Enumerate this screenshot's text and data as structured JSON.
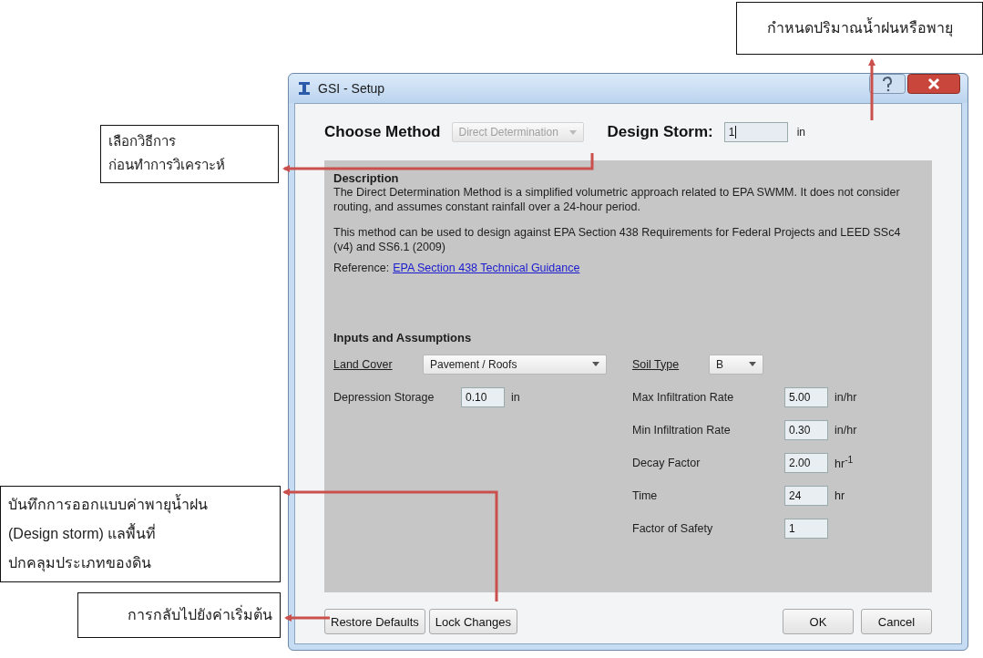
{
  "callouts": [
    {
      "text": "กำหนดปริมาณน้ำฝนหรือพายุ"
    },
    {
      "text": "เลือกวิธีการ\nก่อนทำการวิเคราะห์"
    },
    {
      "text": "บันทึกการออกแบบค่าพายุน้ำฝน\n(Design storm) แลพื้นที่\nปกคลุมประเภทของดิน"
    },
    {
      "text": "การกลับไปยังค่าเริ่มต้น"
    }
  ],
  "dialog": {
    "title": "GSI - Setup",
    "method": {
      "label": "Choose Method",
      "value": "Direct Determination",
      "disabled": true
    },
    "design_storm": {
      "label": "Design Storm:",
      "value": "1",
      "unit": "in"
    },
    "description": {
      "heading": "Description",
      "paragraphs": [
        "The Direct Determination Method is a simplified volumetric approach related to EPA SWMM. It does not consider routing, and assumes constant rainfall over a 24-hour period.",
        "This method can be used to design against EPA Section 438 Requirements for Federal Projects and LEED SSc4 (v4) and SS6.1 (2009)"
      ],
      "reference_label": "Reference:",
      "reference_link": "EPA Section 438 Technical Guidance"
    },
    "inputs": {
      "heading": "Inputs and Assumptions",
      "land_cover": {
        "label": "Land Cover",
        "value": "Pavement / Roofs"
      },
      "soil_type": {
        "label": "Soil Type",
        "value": "B"
      },
      "left_params": [
        {
          "label": "Depression Storage",
          "value": "0.10",
          "unit": "in"
        }
      ],
      "right_params": [
        {
          "label": "Max Infiltration Rate",
          "value": "5.00",
          "unit": "in/hr"
        },
        {
          "label": "Min Infiltration Rate",
          "value": "0.30",
          "unit": "in/hr"
        },
        {
          "label": "Decay Factor",
          "value": "2.00",
          "unit": "hr$^{-1}$"
        },
        {
          "label": "Time",
          "value": "24",
          "unit": "hr"
        },
        {
          "label": "Factor of Safety",
          "value": "1"
        }
      ]
    },
    "buttons_left": [
      "Restore Defaults",
      "Lock Changes"
    ],
    "buttons_right": [
      "OK",
      "Cancel"
    ]
  }
}
